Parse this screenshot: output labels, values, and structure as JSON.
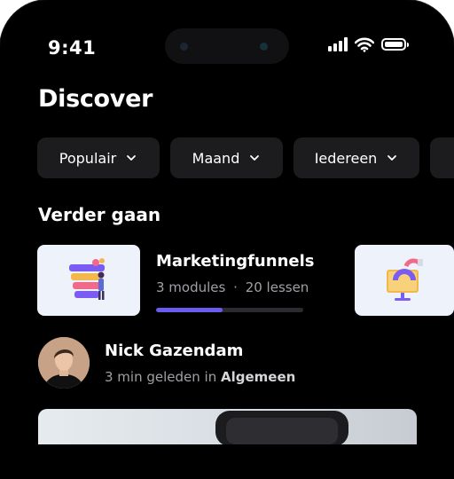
{
  "status_bar": {
    "time": "9:41"
  },
  "page": {
    "title": "Discover"
  },
  "filters": [
    {
      "label": "Populair"
    },
    {
      "label": "Maand"
    },
    {
      "label": "Iedereen"
    }
  ],
  "section": {
    "title": "Verder gaan"
  },
  "course": {
    "title": "Marketingfunnels",
    "modules": "3 modules",
    "separator": "·",
    "lessons": "20 lessen",
    "progress": 0.45
  },
  "post": {
    "author": "Nick Gazendam",
    "time_prefix": "3 min geleden in",
    "channel": "Algemeen"
  },
  "colors": {
    "background": "#000000",
    "chip": "#1c1c1e",
    "accent": "#6a5cf0",
    "muted_text": "#a0a0a6"
  },
  "icons": [
    "signal-icon",
    "wifi-icon",
    "battery-icon",
    "chevron-down-icon"
  ]
}
